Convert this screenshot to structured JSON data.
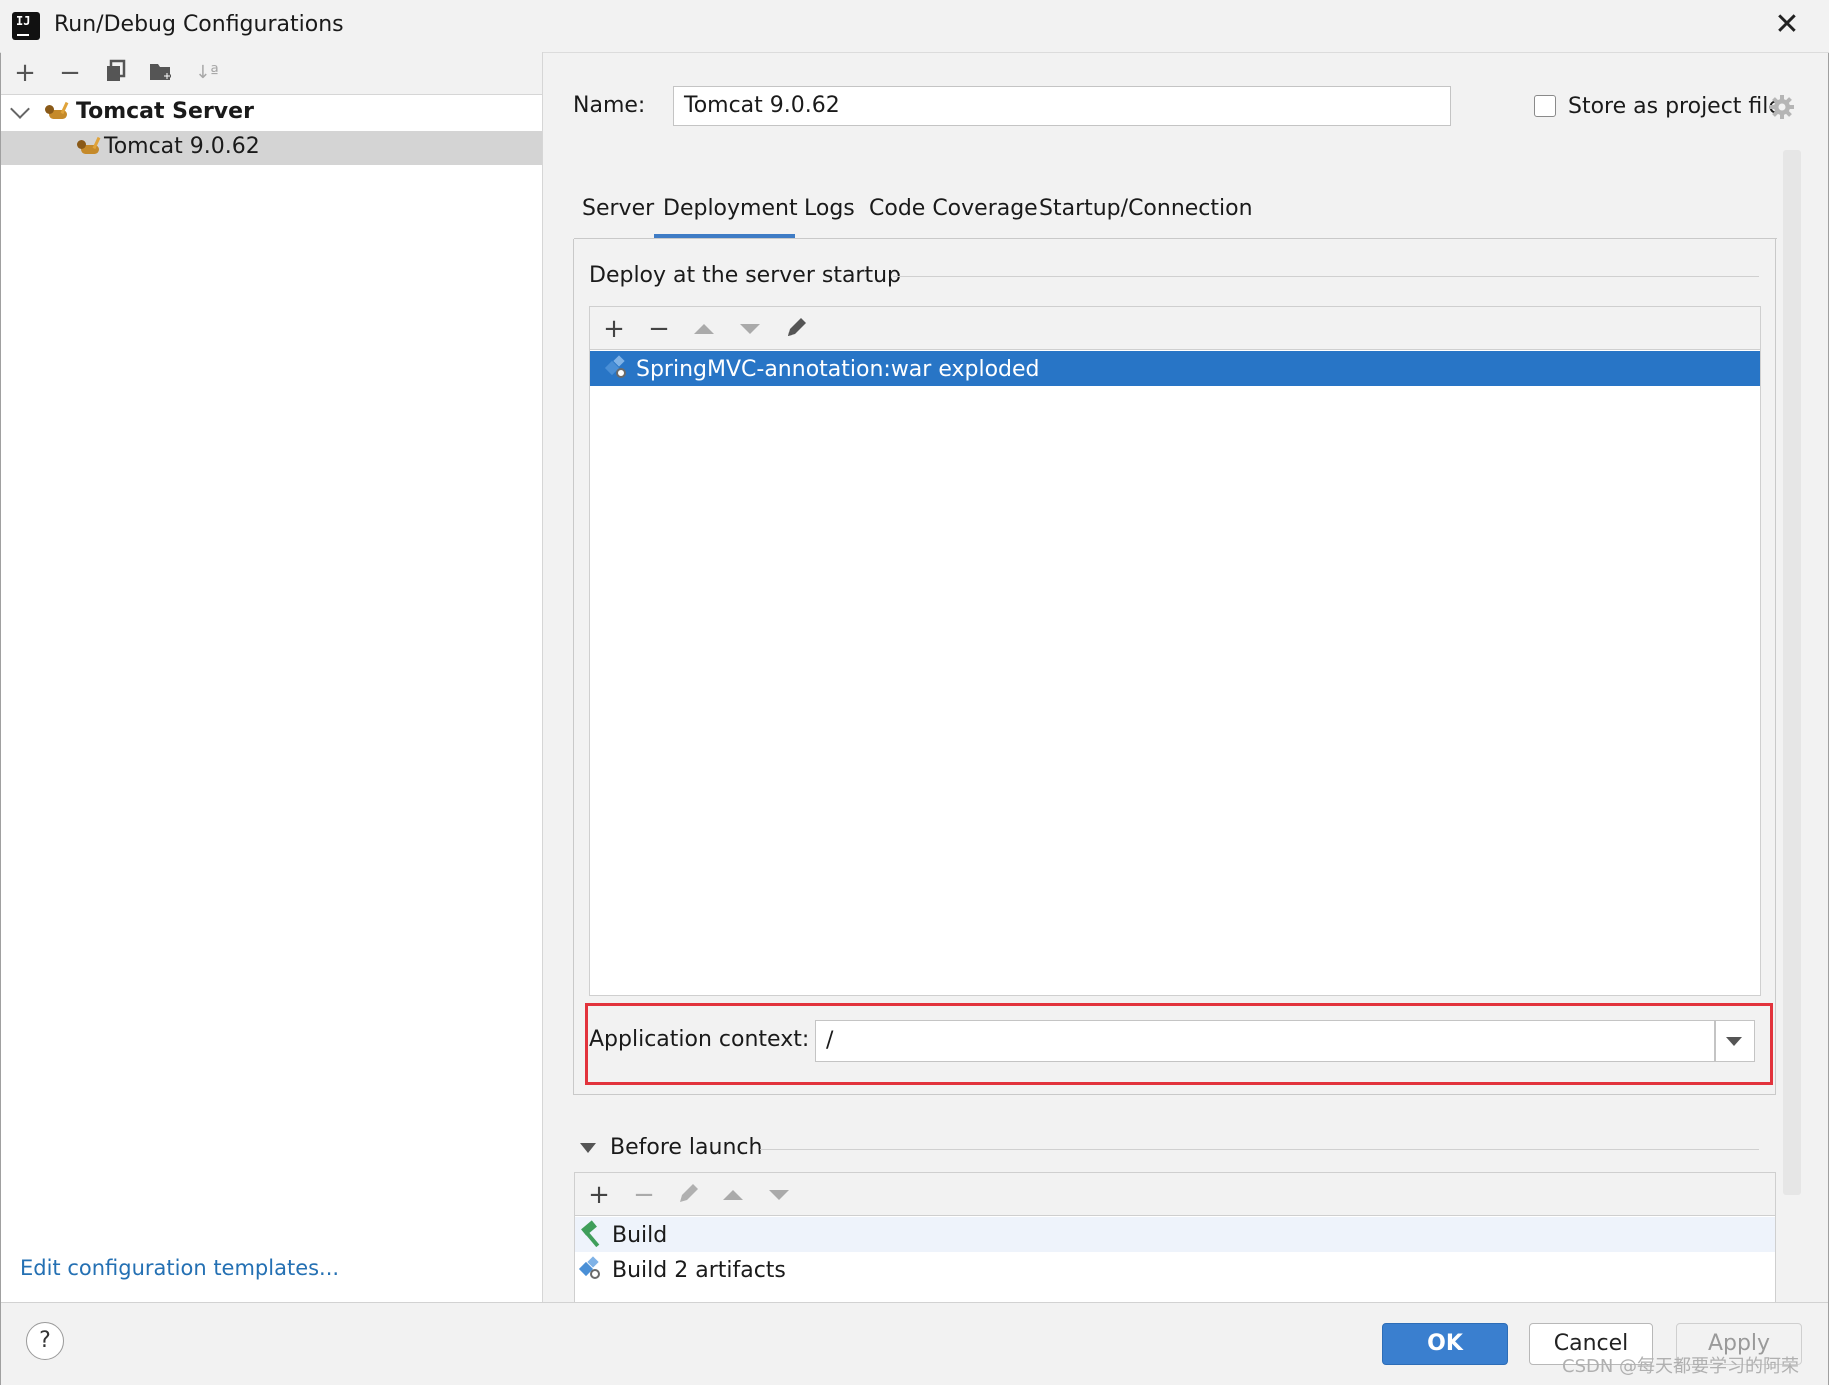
{
  "window": {
    "title": "Run/Debug Configurations",
    "close_glyph": "✕"
  },
  "left_toolbar": {
    "icons": [
      "add-icon",
      "remove-icon",
      "copy-icon",
      "new-folder-icon",
      "sort-icon"
    ],
    "add_glyph": "+",
    "remove_glyph": "−",
    "sort_glyph": "↓ª"
  },
  "tree": {
    "group_label": "Tomcat Server",
    "item_label": "Tomcat 9.0.62"
  },
  "edit_templates_link": "Edit configuration templates...",
  "name_label": "Name:",
  "name_value": "Tomcat 9.0.62",
  "store_as_project_file": {
    "label": "Store as project file",
    "checked": false
  },
  "tabs": [
    {
      "label": "Server"
    },
    {
      "label": "Deployment",
      "active": true
    },
    {
      "label": "Logs"
    },
    {
      "label": "Code Coverage"
    },
    {
      "label": "Startup/Connection"
    }
  ],
  "deploy": {
    "group_title": "Deploy at the server startup",
    "items": [
      "SpringMVC-annotation:war exploded"
    ],
    "selected_index": 0
  },
  "application_context": {
    "label": "Application context:",
    "value": "/"
  },
  "before_launch": {
    "title": "Before launch",
    "items": [
      "Build",
      "Build 2 artifacts"
    ]
  },
  "buttons": {
    "help": "?",
    "ok": "OK",
    "cancel": "Cancel",
    "apply": "Apply"
  },
  "watermark": "CSDN @每天都要学习的阿荣",
  "colors": {
    "accent": "#2875c6",
    "highlight": "#e2333c",
    "link": "#2470b3"
  }
}
